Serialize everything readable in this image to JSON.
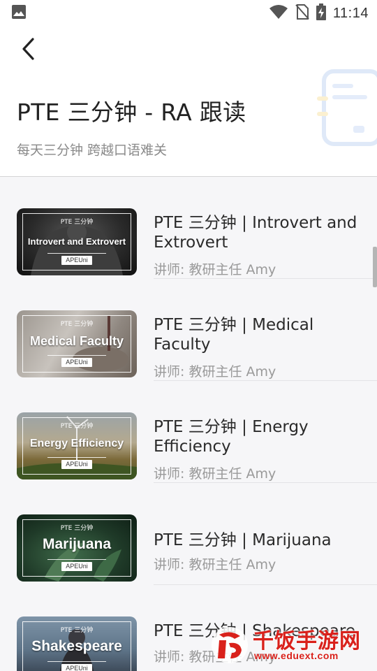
{
  "status_bar": {
    "time": "11:14",
    "icons": [
      "image-icon",
      "wifi-icon",
      "no-sim-icon",
      "battery-charging-icon"
    ]
  },
  "header": {
    "back_icon": "chevron-left-icon",
    "title": "PTE 三分钟 - RA 跟读",
    "subtitle": "每天三分钟 跨越口语难关",
    "illustration_icon": "book-icon"
  },
  "colors": {
    "list_background": "#f6f6f8",
    "title_text": "#2a2a2a",
    "secondary_text": "#9a9a9a",
    "watermark_red": "#d9211b"
  },
  "courses": [
    {
      "title": "PTE 三分钟 | Introvert and Extrovert",
      "author": "讲师: 教研主任 Amy",
      "thumb_top": "PTE 三分钟",
      "thumb_title": "Introvert and Extrovert",
      "thumb_brand": "APEUni"
    },
    {
      "title": "PTE 三分钟 | Medical Faculty",
      "author": "讲师: 教研主任 Amy",
      "thumb_top": "PTE 三分钟",
      "thumb_title": "Medical Faculty",
      "thumb_brand": "APEUni"
    },
    {
      "title": "PTE 三分钟 | Energy Efficiency",
      "author": "讲师: 教研主任 Amy",
      "thumb_top": "PTE 三分钟",
      "thumb_title": "Energy Efficiency",
      "thumb_brand": "APEUni"
    },
    {
      "title": "PTE 三分钟 | Marijuana",
      "author": "讲师: 教研主任 Amy",
      "thumb_top": "PTE 三分钟",
      "thumb_title": "Marijuana",
      "thumb_brand": "APEUni"
    },
    {
      "title": "PTE 三分钟 | Shakespeare",
      "author": "讲师: 教研主任 Amy",
      "thumb_top": "PTE 三分钟",
      "thumb_title": "Shakespeare",
      "thumb_brand": "APEUni"
    }
  ],
  "watermark": {
    "brand": "千饭手游网",
    "url": "www.eduext.com"
  }
}
